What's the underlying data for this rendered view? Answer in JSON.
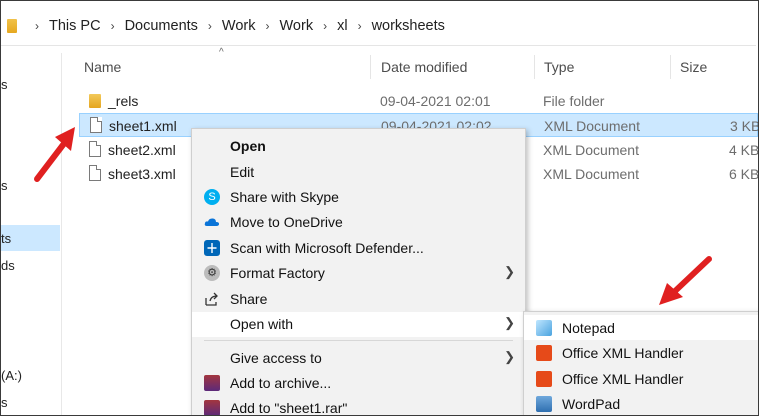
{
  "breadcrumb": [
    "This PC",
    "Documents",
    "Work",
    "Work",
    "xl",
    "worksheets"
  ],
  "nav": {
    "items": [
      "s",
      "s",
      "ts",
      "ds",
      "(A:)",
      "s"
    ]
  },
  "columns": {
    "name": "Name",
    "date": "Date modified",
    "type": "Type",
    "size": "Size"
  },
  "files": [
    {
      "name": "_rels",
      "date": "09-04-2021 02:01",
      "type": "File folder",
      "size": ""
    },
    {
      "name": "sheet1.xml",
      "date": "09-04-2021 02:02",
      "type": "XML Document",
      "size": "3 KB"
    },
    {
      "name": "sheet2.xml",
      "date": "",
      "type": "XML Document",
      "size": "4 KB"
    },
    {
      "name": "sheet3.xml",
      "date": "",
      "type": "XML Document",
      "size": "6 KB"
    }
  ],
  "context_menu": {
    "open": "Open",
    "edit": "Edit",
    "skype": "Share with Skype",
    "onedrive": "Move to OneDrive",
    "defender": "Scan with Microsoft Defender...",
    "format_factory": "Format Factory",
    "share": "Share",
    "open_with": "Open with",
    "give_access": "Give access to",
    "add_archive": "Add to archive...",
    "add_rar": "Add to \"sheet1.rar\""
  },
  "open_with_menu": [
    "Notepad",
    "Office XML Handler",
    "Office XML Handler",
    "WordPad"
  ],
  "colors": {
    "selection": "#cce8ff",
    "annotation_arrow": "#e02020"
  }
}
